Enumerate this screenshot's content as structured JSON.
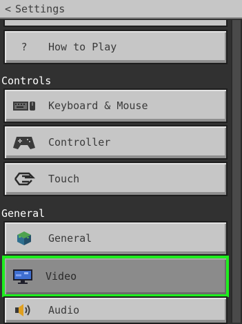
{
  "header": {
    "back_label": "Settings"
  },
  "sections": {
    "controls": "Controls",
    "general": "General"
  },
  "items": {
    "how_to_play": {
      "label": "How to Play",
      "icon_text": "?"
    },
    "keyboard": {
      "label": "Keyboard & Mouse"
    },
    "controller": {
      "label": "Controller"
    },
    "touch": {
      "label": "Touch"
    },
    "general": {
      "label": "General"
    },
    "video": {
      "label": "Video"
    },
    "audio": {
      "label": "Audio"
    }
  },
  "colors": {
    "selection_outline": "#1eee1e",
    "panel": "#c6c6c6",
    "background": "#313131"
  }
}
